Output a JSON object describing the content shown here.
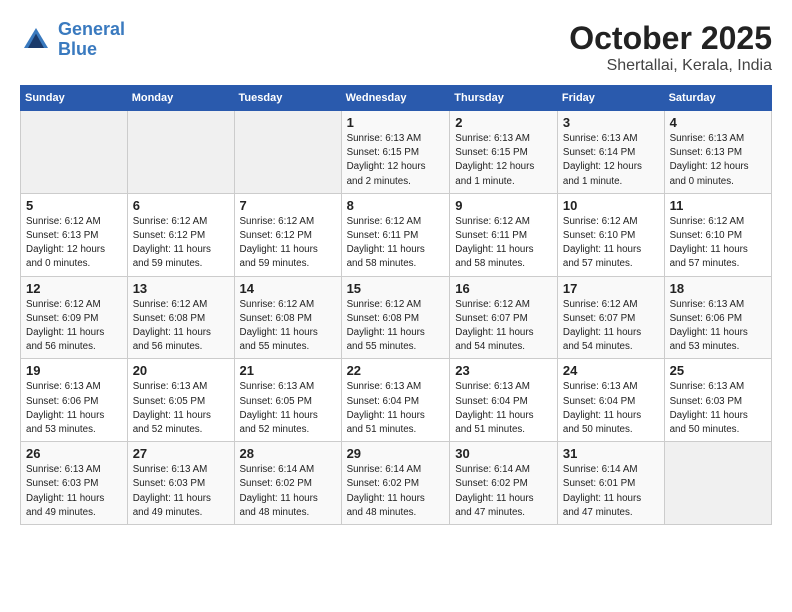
{
  "header": {
    "logo_line1": "General",
    "logo_line2": "Blue",
    "month_title": "October 2025",
    "subtitle": "Shertallai, Kerala, India"
  },
  "days_of_week": [
    "Sunday",
    "Monday",
    "Tuesday",
    "Wednesday",
    "Thursday",
    "Friday",
    "Saturday"
  ],
  "weeks": [
    [
      {
        "day": "",
        "info": ""
      },
      {
        "day": "",
        "info": ""
      },
      {
        "day": "",
        "info": ""
      },
      {
        "day": "1",
        "info": "Sunrise: 6:13 AM\nSunset: 6:15 PM\nDaylight: 12 hours\nand 2 minutes."
      },
      {
        "day": "2",
        "info": "Sunrise: 6:13 AM\nSunset: 6:15 PM\nDaylight: 12 hours\nand 1 minute."
      },
      {
        "day": "3",
        "info": "Sunrise: 6:13 AM\nSunset: 6:14 PM\nDaylight: 12 hours\nand 1 minute."
      },
      {
        "day": "4",
        "info": "Sunrise: 6:13 AM\nSunset: 6:13 PM\nDaylight: 12 hours\nand 0 minutes."
      }
    ],
    [
      {
        "day": "5",
        "info": "Sunrise: 6:12 AM\nSunset: 6:13 PM\nDaylight: 12 hours\nand 0 minutes."
      },
      {
        "day": "6",
        "info": "Sunrise: 6:12 AM\nSunset: 6:12 PM\nDaylight: 11 hours\nand 59 minutes."
      },
      {
        "day": "7",
        "info": "Sunrise: 6:12 AM\nSunset: 6:12 PM\nDaylight: 11 hours\nand 59 minutes."
      },
      {
        "day": "8",
        "info": "Sunrise: 6:12 AM\nSunset: 6:11 PM\nDaylight: 11 hours\nand 58 minutes."
      },
      {
        "day": "9",
        "info": "Sunrise: 6:12 AM\nSunset: 6:11 PM\nDaylight: 11 hours\nand 58 minutes."
      },
      {
        "day": "10",
        "info": "Sunrise: 6:12 AM\nSunset: 6:10 PM\nDaylight: 11 hours\nand 57 minutes."
      },
      {
        "day": "11",
        "info": "Sunrise: 6:12 AM\nSunset: 6:10 PM\nDaylight: 11 hours\nand 57 minutes."
      }
    ],
    [
      {
        "day": "12",
        "info": "Sunrise: 6:12 AM\nSunset: 6:09 PM\nDaylight: 11 hours\nand 56 minutes."
      },
      {
        "day": "13",
        "info": "Sunrise: 6:12 AM\nSunset: 6:08 PM\nDaylight: 11 hours\nand 56 minutes."
      },
      {
        "day": "14",
        "info": "Sunrise: 6:12 AM\nSunset: 6:08 PM\nDaylight: 11 hours\nand 55 minutes."
      },
      {
        "day": "15",
        "info": "Sunrise: 6:12 AM\nSunset: 6:08 PM\nDaylight: 11 hours\nand 55 minutes."
      },
      {
        "day": "16",
        "info": "Sunrise: 6:12 AM\nSunset: 6:07 PM\nDaylight: 11 hours\nand 54 minutes."
      },
      {
        "day": "17",
        "info": "Sunrise: 6:12 AM\nSunset: 6:07 PM\nDaylight: 11 hours\nand 54 minutes."
      },
      {
        "day": "18",
        "info": "Sunrise: 6:13 AM\nSunset: 6:06 PM\nDaylight: 11 hours\nand 53 minutes."
      }
    ],
    [
      {
        "day": "19",
        "info": "Sunrise: 6:13 AM\nSunset: 6:06 PM\nDaylight: 11 hours\nand 53 minutes."
      },
      {
        "day": "20",
        "info": "Sunrise: 6:13 AM\nSunset: 6:05 PM\nDaylight: 11 hours\nand 52 minutes."
      },
      {
        "day": "21",
        "info": "Sunrise: 6:13 AM\nSunset: 6:05 PM\nDaylight: 11 hours\nand 52 minutes."
      },
      {
        "day": "22",
        "info": "Sunrise: 6:13 AM\nSunset: 6:04 PM\nDaylight: 11 hours\nand 51 minutes."
      },
      {
        "day": "23",
        "info": "Sunrise: 6:13 AM\nSunset: 6:04 PM\nDaylight: 11 hours\nand 51 minutes."
      },
      {
        "day": "24",
        "info": "Sunrise: 6:13 AM\nSunset: 6:04 PM\nDaylight: 11 hours\nand 50 minutes."
      },
      {
        "day": "25",
        "info": "Sunrise: 6:13 AM\nSunset: 6:03 PM\nDaylight: 11 hours\nand 50 minutes."
      }
    ],
    [
      {
        "day": "26",
        "info": "Sunrise: 6:13 AM\nSunset: 6:03 PM\nDaylight: 11 hours\nand 49 minutes."
      },
      {
        "day": "27",
        "info": "Sunrise: 6:13 AM\nSunset: 6:03 PM\nDaylight: 11 hours\nand 49 minutes."
      },
      {
        "day": "28",
        "info": "Sunrise: 6:14 AM\nSunset: 6:02 PM\nDaylight: 11 hours\nand 48 minutes."
      },
      {
        "day": "29",
        "info": "Sunrise: 6:14 AM\nSunset: 6:02 PM\nDaylight: 11 hours\nand 48 minutes."
      },
      {
        "day": "30",
        "info": "Sunrise: 6:14 AM\nSunset: 6:02 PM\nDaylight: 11 hours\nand 47 minutes."
      },
      {
        "day": "31",
        "info": "Sunrise: 6:14 AM\nSunset: 6:01 PM\nDaylight: 11 hours\nand 47 minutes."
      },
      {
        "day": "",
        "info": ""
      }
    ]
  ]
}
